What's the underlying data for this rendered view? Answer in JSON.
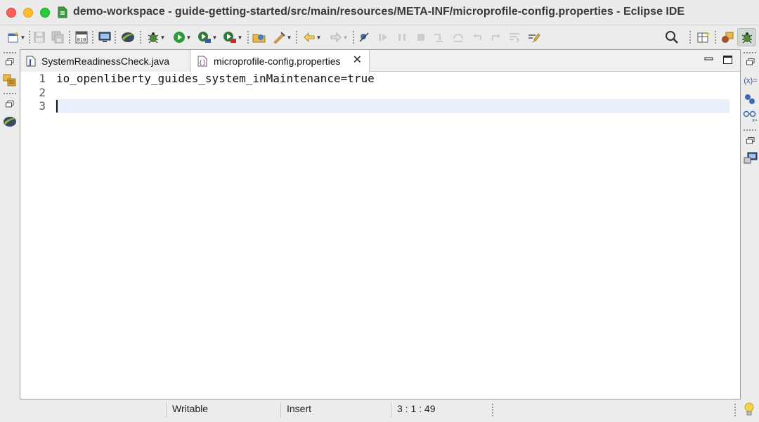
{
  "window": {
    "title": "demo-workspace - guide-getting-started/src/main/resources/META-INF/microprofile-config.properties - Eclipse IDE"
  },
  "toolbar": {
    "items": [
      "new-icon",
      "save-icon",
      "save-all-icon",
      "binary-icon",
      "terminal-icon",
      "eclipse-icon",
      "debug-icon",
      "run-icon",
      "coverage-icon",
      "external-tools-icon",
      "open-type-icon",
      "build-icon",
      "back-icon",
      "forward-icon",
      "skip-breakpoints-icon",
      "resume-icon",
      "suspend-icon",
      "terminate-icon",
      "step-into-icon",
      "step-over-icon",
      "step-return-icon",
      "drop-to-frame-icon",
      "use-step-filters-icon",
      "search-icon",
      "open-perspective-icon",
      "java-perspective-icon",
      "debug-perspective-icon"
    ]
  },
  "tabs": [
    {
      "label": "SystemReadinessCheck.java",
      "icon": "java-file-icon",
      "active": false
    },
    {
      "label": "microprofile-config.properties",
      "icon": "properties-file-icon",
      "active": true
    }
  ],
  "editor": {
    "lines": [
      {
        "number": "1",
        "text": "io_openliberty_guides_system_inMaintenance=true"
      },
      {
        "number": "2",
        "text": ""
      },
      {
        "number": "3",
        "text": ""
      }
    ],
    "current_line": 3
  },
  "status": {
    "writable": "Writable",
    "insert_mode": "Insert",
    "position": "3 : 1 : 49"
  },
  "right_trim": {
    "variables_label": "(x)="
  },
  "colors": {
    "current_line_highlight": "#e8f0fb",
    "traffic_close": "#fe5f57",
    "traffic_minimize": "#febc2e",
    "traffic_zoom": "#28c840"
  }
}
